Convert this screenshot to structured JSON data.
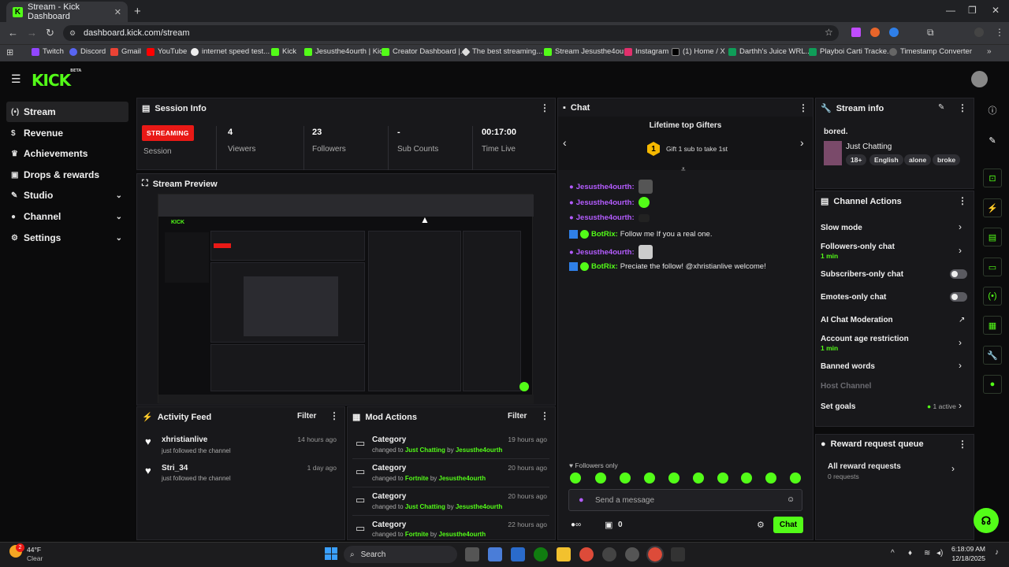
{
  "browser": {
    "tab_title": "Stream - Kick Dashboard",
    "url": "dashboard.kick.com/stream",
    "bookmarks": [
      "Twitch",
      "Discord",
      "Gmail",
      "YouTube",
      "internet speed test...",
      "Kick",
      "Jesusthe4ourth | Kick",
      "Creator Dashboard |...",
      "The best streaming...",
      "Stream Jesusthe4ou...",
      "Instagram",
      "(1) Home / X",
      "Darthh's Juice WRL...",
      "Playboi Carti Tracke...",
      "Timestamp Converter"
    ]
  },
  "brand": {
    "logo": "KICK",
    "beta": "BETA",
    "accent": "#53fc18"
  },
  "sidebar": {
    "items": [
      {
        "label": "Stream"
      },
      {
        "label": "Revenue"
      },
      {
        "label": "Achievements"
      },
      {
        "label": "Drops & rewards"
      },
      {
        "label": "Studio"
      },
      {
        "label": "Channel"
      },
      {
        "label": "Settings"
      }
    ]
  },
  "session": {
    "title": "Session Info",
    "badge": "STREAMING",
    "badge_label": "Session",
    "stats": [
      {
        "value": "4",
        "label": "Viewers"
      },
      {
        "value": "23",
        "label": "Followers"
      },
      {
        "value": "-",
        "label": "Sub Counts"
      },
      {
        "value": "00:17:00",
        "label": "Time Live"
      }
    ]
  },
  "preview": {
    "title": "Stream Preview"
  },
  "activity": {
    "title": "Activity Feed",
    "filter": "Filter",
    "items": [
      {
        "name": "xhristianlive",
        "sub": "just followed the channel",
        "time": "14 hours ago"
      },
      {
        "name": "Stri_34",
        "sub": "just followed the channel",
        "time": "1 day ago"
      }
    ]
  },
  "mod": {
    "title": "Mod Actions",
    "filter": "Filter",
    "changed_to": "changed to",
    "by": "by",
    "items": [
      {
        "title": "Category",
        "value": "Just Chatting",
        "user": "Jesusthe4ourth",
        "time": "19 hours ago"
      },
      {
        "title": "Category",
        "value": "Fortnite",
        "user": "Jesusthe4ourth",
        "time": "20 hours ago"
      },
      {
        "title": "Category",
        "value": "Just Chatting",
        "user": "Jesusthe4ourth",
        "time": "20 hours ago"
      },
      {
        "title": "Category",
        "value": "Fortnite",
        "user": "Jesusthe4ourth",
        "time": "22 hours ago"
      }
    ]
  },
  "chat": {
    "title": "Chat",
    "gifters_title": "Lifetime top Gifters",
    "gifters_rank": "1",
    "gifters_text": "Gift 1 sub to take 1st",
    "messages": [
      {
        "user": "Jesusthe4ourth:",
        "text": ""
      },
      {
        "user": "Jesusthe4ourth:",
        "text": ""
      },
      {
        "user": "Jesusthe4ourth:",
        "text": ""
      },
      {
        "user": "BotRix:",
        "text": "Follow me If you a real one."
      },
      {
        "user": "Jesusthe4ourth:",
        "text": ""
      },
      {
        "user": "BotRix:",
        "text": "Preciate the follow! @xhristianlive welcome!"
      }
    ],
    "followers_only": "Followers only",
    "input_placeholder": "Send a message",
    "points": "0",
    "send": "Chat"
  },
  "stream_info": {
    "title": "Stream info",
    "stream_title": "bored.",
    "category": "Just Chatting",
    "tags": [
      "18+",
      "English",
      "alone",
      "broke"
    ]
  },
  "channel_actions": {
    "title": "Channel Actions",
    "items": [
      {
        "label": "Slow mode"
      },
      {
        "label": "Followers-only chat",
        "sub": "1 min"
      },
      {
        "label": "Subscribers-only chat"
      },
      {
        "label": "Emotes-only chat"
      },
      {
        "label": "AI Chat Moderation"
      },
      {
        "label": "Account age restriction",
        "sub": "1 min"
      },
      {
        "label": "Banned words"
      },
      {
        "label": "Host Channel"
      },
      {
        "label": "Set goals",
        "status": "1 active"
      }
    ]
  },
  "reward_queue": {
    "title": "Reward request queue",
    "item": "All reward requests",
    "count": "0 requests"
  },
  "taskbar": {
    "weather_temp": "44°F",
    "weather_text": "Clear",
    "search": "Search",
    "time": "6:18:09 AM",
    "date": "12/18/2025",
    "badge": "2"
  }
}
